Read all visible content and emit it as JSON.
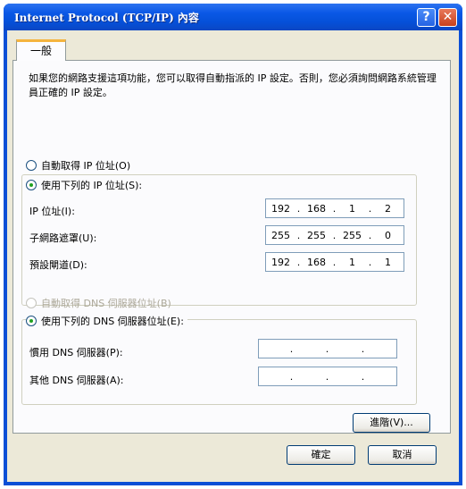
{
  "window": {
    "title": "Internet Protocol (TCP/IP) 內容"
  },
  "titlebar_buttons": {
    "help": "?",
    "close": "✕"
  },
  "tabs": [
    {
      "label": "一般",
      "active": true
    }
  ],
  "description": "如果您的網路支援這項功能，您可以取得自動指派的 IP 設定。否則，您必須詢問網路系統管理員正確的 IP 設定。",
  "ip_section": {
    "auto_option": {
      "label": "自動取得 IP 位址(O)",
      "selected": false
    },
    "manual_option": {
      "label": "使用下列的 IP 位址(S):",
      "selected": true
    },
    "fields": [
      {
        "label": "IP 位址(I):",
        "octets": [
          "192",
          "168",
          "1",
          "2"
        ]
      },
      {
        "label": "子網路遮罩(U):",
        "octets": [
          "255",
          "255",
          "255",
          "0"
        ]
      },
      {
        "label": "預設閘道(D):",
        "octets": [
          "192",
          "168",
          "1",
          "1"
        ]
      }
    ]
  },
  "dns_section": {
    "auto_option": {
      "label": "自動取得 DNS 伺服器位址(B)",
      "selected": false,
      "disabled": true
    },
    "manual_option": {
      "label": "使用下列的 DNS 伺服器位址(E):",
      "selected": true
    },
    "fields": [
      {
        "label": "慣用 DNS 伺服器(P):",
        "octets": [
          "",
          "",
          "",
          ""
        ]
      },
      {
        "label": "其他 DNS 伺服器(A):",
        "octets": [
          "",
          "",
          "",
          ""
        ]
      }
    ]
  },
  "advanced_button": "進階(V)...",
  "ok_button": "確定",
  "cancel_button": "取消",
  "colors": {
    "titlebar": "#0a58e6",
    "dialog_bg": "#ece9d8",
    "tab_accent": "#f5b43e"
  }
}
